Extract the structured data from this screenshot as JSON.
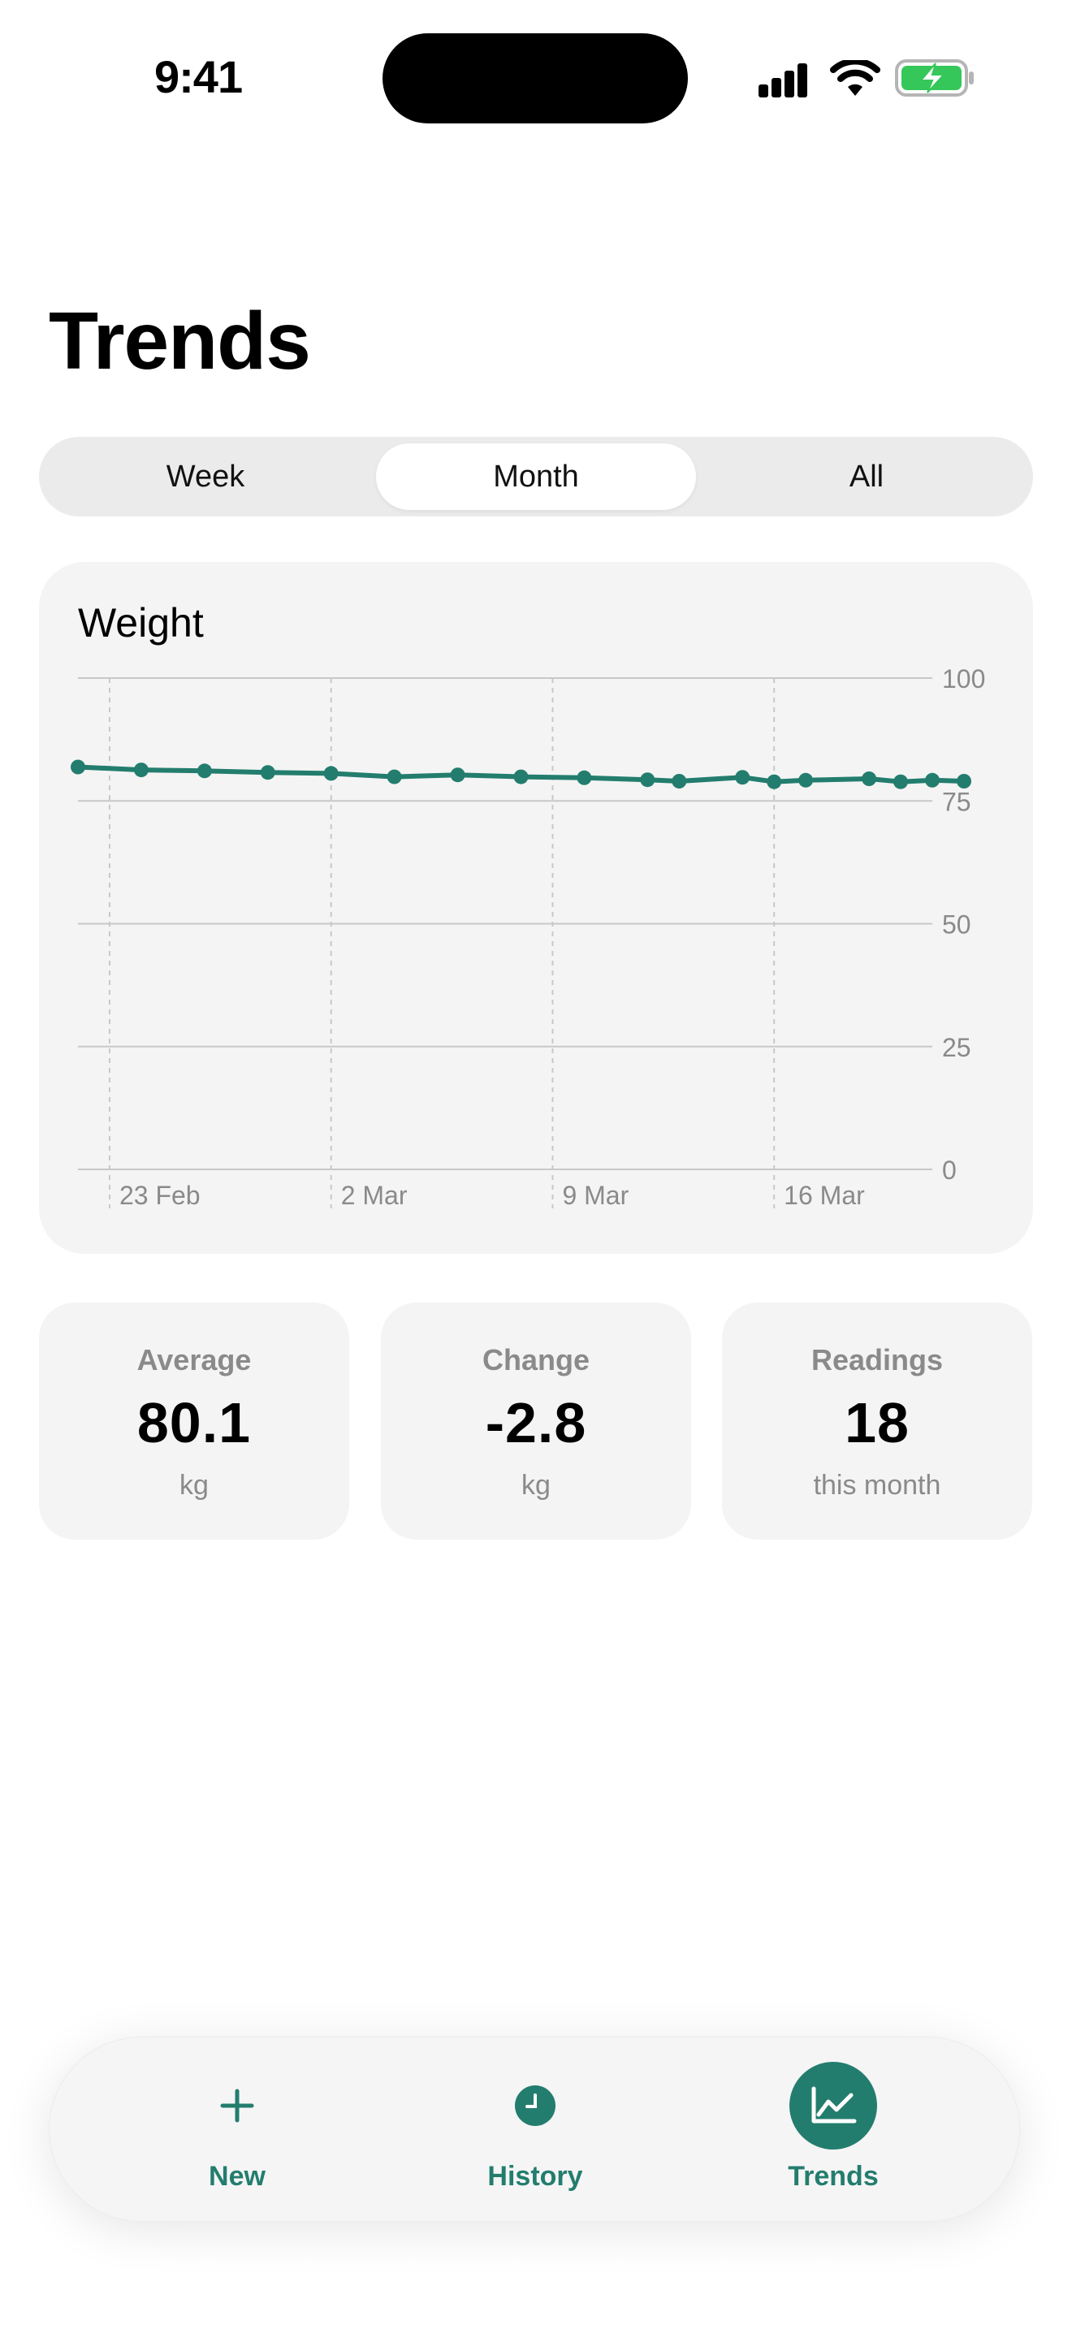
{
  "status_bar": {
    "time": "9:41"
  },
  "page": {
    "title": "Trends"
  },
  "segments": [
    {
      "label": "Week",
      "active": false
    },
    {
      "label": "Month",
      "active": true
    },
    {
      "label": "All",
      "active": false
    }
  ],
  "accent_color": "#237d6e",
  "chart_data": {
    "type": "line",
    "title": "Weight",
    "xlabel": "",
    "ylabel": "",
    "ylim": [
      0,
      100
    ],
    "y_ticks": [
      100,
      75,
      50,
      25,
      0
    ],
    "x_tick_labels": [
      "23 Feb",
      "2 Mar",
      "9 Mar",
      "16 Mar"
    ],
    "x_range": [
      "2025-02-22",
      "2025-03-21"
    ],
    "grid": true,
    "series": [
      {
        "color": "#237d6e",
        "points": [
          {
            "date": "2025-02-22",
            "value": 81.9
          },
          {
            "date": "2025-02-24",
            "value": 81.3
          },
          {
            "date": "2025-02-26",
            "value": 81.1
          },
          {
            "date": "2025-02-28",
            "value": 80.8
          },
          {
            "date": "2025-03-02",
            "value": 80.6
          },
          {
            "date": "2025-03-04",
            "value": 79.9
          },
          {
            "date": "2025-03-06",
            "value": 80.3
          },
          {
            "date": "2025-03-08",
            "value": 79.9
          },
          {
            "date": "2025-03-10",
            "value": 79.7
          },
          {
            "date": "2025-03-12",
            "value": 79.3
          },
          {
            "date": "2025-03-13",
            "value": 79.0
          },
          {
            "date": "2025-03-15",
            "value": 79.8
          },
          {
            "date": "2025-03-16",
            "value": 78.9
          },
          {
            "date": "2025-03-17",
            "value": 79.2
          },
          {
            "date": "2025-03-19",
            "value": 79.5
          },
          {
            "date": "2025-03-20",
            "value": 78.9
          },
          {
            "date": "2025-03-21",
            "value": 79.2
          },
          {
            "date": "2025-03-22",
            "value": 79.0
          }
        ]
      }
    ]
  },
  "stats": [
    {
      "label": "Average",
      "value": "80.1",
      "unit": "kg"
    },
    {
      "label": "Change",
      "value": "-2.8",
      "unit": "kg"
    },
    {
      "label": "Readings",
      "value": "18",
      "unit": "this month"
    }
  ],
  "tab_bar": {
    "tabs": [
      {
        "label": "New",
        "icon": "plus-icon",
        "active": false
      },
      {
        "label": "History",
        "icon": "clock-icon",
        "active": false
      },
      {
        "label": "Trends",
        "icon": "chart-icon",
        "active": true
      }
    ]
  }
}
